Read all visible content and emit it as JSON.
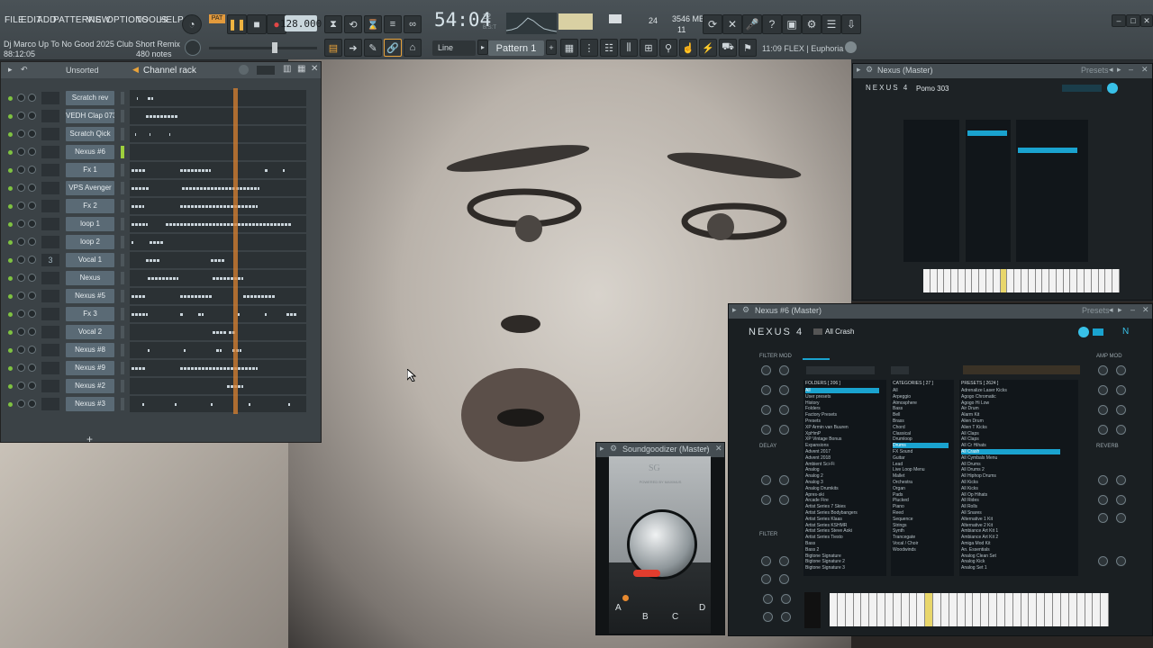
{
  "menu": [
    "FILE",
    "EDIT",
    "ADD",
    "PATTERNS",
    "VIEW",
    "OPTIONS",
    "TOOLS",
    "HELP"
  ],
  "transport": {
    "pat_label": "PAT",
    "tempo": "128.000",
    "clock": "54:04",
    "clock_sub": "22",
    "clock_unit": "B:S:T"
  },
  "monitor": {
    "cpu": "24",
    "memory": "3546 MB",
    "polyphony": "11"
  },
  "song": {
    "title": "Dj Marco Up To No Good 2025 Club Short Remix",
    "time": "88:12:05",
    "notes": "480 notes"
  },
  "toolbar": {
    "snap": "Line",
    "pattern": "Pattern 1",
    "hint": "11:09  FLEX | Euphoria"
  },
  "channel_rack": {
    "title": "Channel rack",
    "filter": "Unsorted",
    "add_label": "+",
    "channels": [
      {
        "num": "",
        "name": "Scratch rev"
      },
      {
        "num": "",
        "name": "VEDH Clap 073"
      },
      {
        "num": "",
        "name": "Scratch Qick"
      },
      {
        "num": "",
        "name": "Nexus #6",
        "selected": true
      },
      {
        "num": "",
        "name": "Fx 1"
      },
      {
        "num": "",
        "name": "VPS Avenger"
      },
      {
        "num": "",
        "name": "Fx 2"
      },
      {
        "num": "",
        "name": "loop 1"
      },
      {
        "num": "",
        "name": "loop 2"
      },
      {
        "num": "3",
        "name": "Vocal 1"
      },
      {
        "num": "",
        "name": "Nexus"
      },
      {
        "num": "",
        "name": "Nexus #5"
      },
      {
        "num": "",
        "name": "Fx 3"
      },
      {
        "num": "",
        "name": "Vocal 2"
      },
      {
        "num": "",
        "name": "Nexus #8"
      },
      {
        "num": "",
        "name": "Nexus #9"
      },
      {
        "num": "",
        "name": "Nexus #2"
      },
      {
        "num": "",
        "name": "Nexus #3"
      }
    ]
  },
  "nexus_master": {
    "title": "Nexus (Master)",
    "presets_label": "Presets",
    "logo": "NEXUS 4",
    "preset": "Pomo 303"
  },
  "nexus6": {
    "title": "Nexus #6 (Master)",
    "presets_label": "Presets",
    "logo": "NEXUS 4",
    "preset": "All Crash",
    "sections": [
      "FILTER MOD",
      "DELAY",
      "FILTER",
      "AMP MOD",
      "REVERB"
    ],
    "folders_header": "FOLDERS [ 206 ]",
    "folders": [
      "All",
      "User presets",
      "History",
      "Folders",
      "Factory Presets",
      "Presets",
      "XP Armin van Buuren",
      "XpHmP",
      "XP Vintage Bonus",
      "Expansions",
      "Advent 2017",
      "Advent 2018",
      "Ambient Sci-Fi",
      "Analog",
      "Analog 2",
      "Analog 3",
      "Analog Drumkits",
      "Apres-ski",
      "Arcade Fire",
      "Artist Series 7 Skies",
      "Artist Series Bodybangers",
      "Artist Series Klaas",
      "Artist Series KSHMR",
      "Artist Series Steve Aoki",
      "Artist Series Tiesto",
      "Bass",
      "Bass 2",
      "Bigtone Signature",
      "Bigtone Signature 2",
      "Bigtone Signature 3"
    ],
    "categories_header": "CATEGORIES [ 27 ]",
    "categories": [
      "All",
      "Arpeggio",
      "Atmosphere",
      "Bass",
      "Bell",
      "Brass",
      "Chord",
      "Classical",
      "Drumloop",
      "Drums",
      "FX Sound",
      "Guitar",
      "Lead",
      "Live Loop Menu",
      "Mallet",
      "Orchestra",
      "Organ",
      "Pads",
      "Plucked",
      "Piano",
      "Reed",
      "Sequence",
      "Strings",
      "Synth",
      "Trancegate",
      "Vocal / Choir",
      "Woodwinds"
    ],
    "presets_header": "PRESETS [ 2624 ]",
    "presets": [
      "Adrenalize Laser Kicks",
      "Agogo Chromatic",
      "Agogo Hi Low",
      "Air Drum",
      "Alarm Kit",
      "Alien Drum",
      "Alien T Kicks",
      "All Claps",
      "All Claps",
      "All Cr Hihats",
      "All Crash",
      "All Cymbals Menu",
      "All Drums",
      "All Drums 2",
      "All Hiphop Drums",
      "All Kicks",
      "All Kicks",
      "All Op Hihats",
      "All Rides",
      "All Rolls",
      "All Snares",
      "Alternative 1 Kit",
      "Alternative 2 Kit",
      "Ambiance Art Kit 1",
      "Ambiance Art Kit 2",
      "Amiga Mod Kit",
      "An. Essentials",
      "Analog Clean Set",
      "Analog Kick",
      "Analog Set 1"
    ]
  },
  "soundgoodizer": {
    "title": "Soundgoodizer (Master)",
    "badge": "POWERED BY MAXIMUS",
    "modes": [
      "A",
      "B",
      "C",
      "D"
    ]
  }
}
